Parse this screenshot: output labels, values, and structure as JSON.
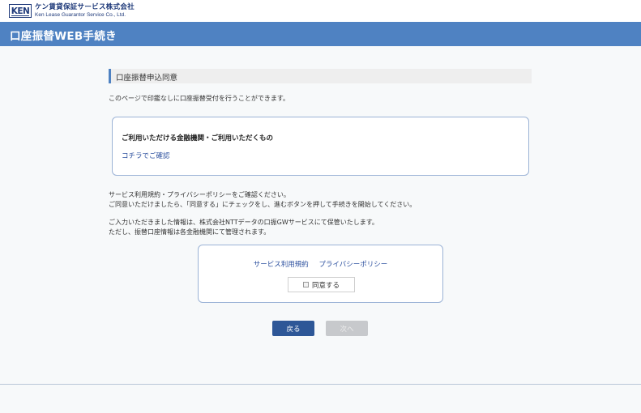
{
  "header": {
    "logo_mark": "KEN",
    "company_jp": "ケン賃貸保証サービス株式会社",
    "company_en": "Ken Lease Guarantor Service Co., Ltd."
  },
  "title_bar": {
    "title": "口座振替WEB手続き"
  },
  "section": {
    "heading": "口座振替申込同意",
    "intro": "このページで印鑑なしに口座振替受付を行うことができます。"
  },
  "info_box": {
    "title": "ご利用いただける金融機関・ご利用いただくもの",
    "link": "コチラでご確認"
  },
  "notes": {
    "line1": "サービス利用規約・プライバシーポリシーをご確認ください。",
    "line2": "ご同意いただけましたら、「同意する」にチェックをし、進むボタンを押して手続きを開始してください。",
    "line3": "ご入力いただきました情報は、株式会社NTTデータの口振GWサービスにて保管いたします。",
    "line4": "ただし、振替口座情報は各金融機関にて管理されます。"
  },
  "agree_box": {
    "terms_link": "サービス利用規約",
    "privacy_link": "プライバシーポリシー",
    "agree_label": "同意する",
    "agree_checked": false
  },
  "buttons": {
    "back": "戻る",
    "next": "次へ"
  },
  "colors": {
    "title_bar": "#4f82c2",
    "primary_button": "#2e5797",
    "disabled_button": "#c7c9cc",
    "link": "#2b4f9e",
    "box_border": "#9bb3d6"
  }
}
